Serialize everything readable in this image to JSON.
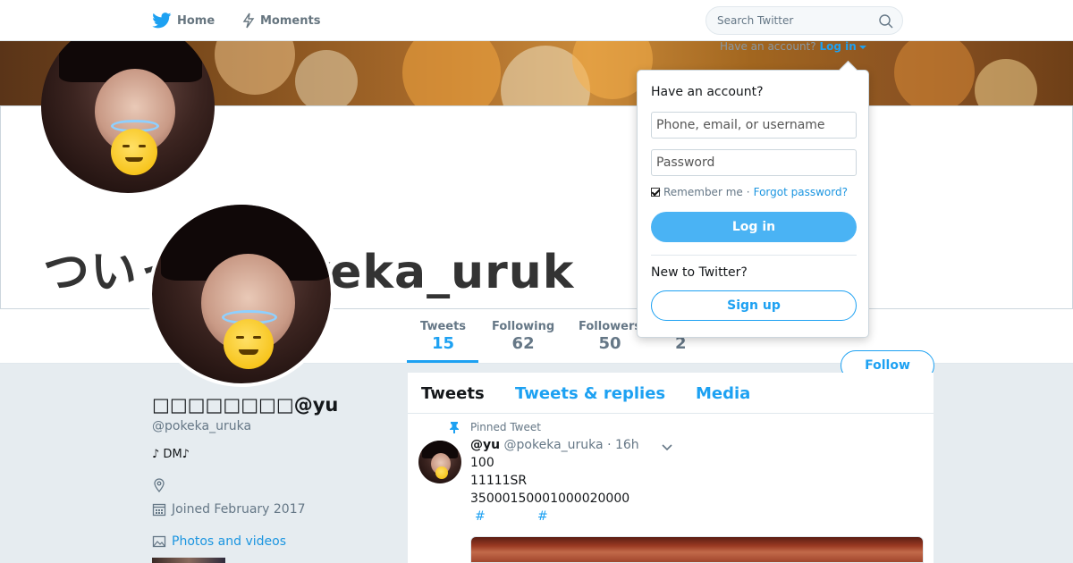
{
  "nav": {
    "home_label": "Home",
    "moments_label": "Moments",
    "search_placeholder": "Search Twitter",
    "have_account_text": "Have an account?",
    "login_label": "Log in"
  },
  "header": {
    "title_text": "ついっ@pokeka_uruk"
  },
  "stats": {
    "tweets_label": "Tweets",
    "tweets_value": "15",
    "following_label": "Following",
    "following_value": "62",
    "followers_label": "Followers",
    "followers_value": "50",
    "likes_value": "2",
    "follow_button": "Follow"
  },
  "profile": {
    "name": "□□□□□□□□@yu",
    "handle": "@pokeka_uruka",
    "bio": "♪ DM♪",
    "joined": "Joined February 2017",
    "photos_label": "Photos and videos"
  },
  "timeline": {
    "tabs": [
      "Tweets",
      "Tweets & replies",
      "Media"
    ],
    "pinned_label": "Pinned Tweet",
    "tweet": {
      "name": "@yu",
      "handle": "@pokeka_uruka",
      "time": "· 16h",
      "lines": [
        "100",
        "11111SR",
        "35000150001000020000"
      ],
      "hashtags": [
        "#",
        "#"
      ]
    }
  },
  "login_dropdown": {
    "title": "Have an account?",
    "username_placeholder": "Phone, email, or username",
    "password_placeholder": "Password",
    "remember_label": "Remember me",
    "separator": "·",
    "forgot_label": "Forgot password?",
    "login_button": "Log in",
    "new_label": "New to Twitter?",
    "signup_button": "Sign up"
  },
  "colors": {
    "brand_blue": "#1da1f2",
    "login_button_blue": "#4ab3f4",
    "background": "#e6ecf0"
  }
}
